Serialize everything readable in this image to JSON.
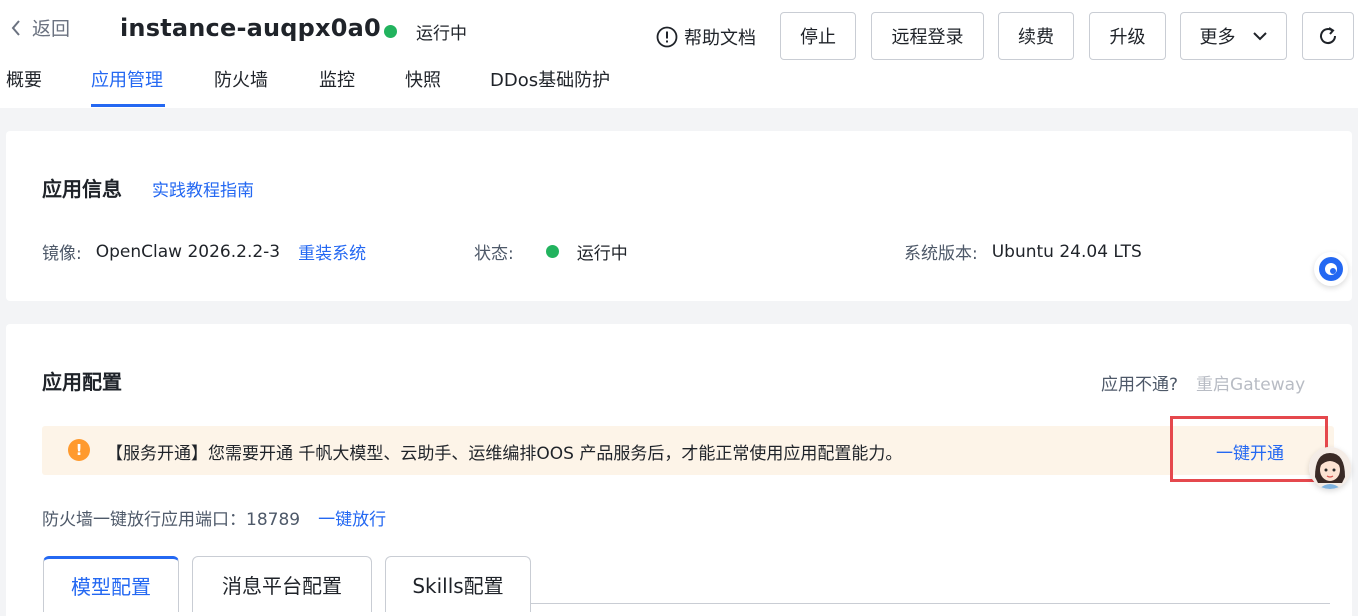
{
  "header": {
    "back_label": "返回",
    "instance_name": "instance-auqpx0a0",
    "status_text": "运行中",
    "status_color": "#22b35e",
    "help_label": "帮助文档",
    "buttons": {
      "stop": "停止",
      "remote_login": "远程登录",
      "renew": "续费",
      "upgrade": "升级",
      "more": "更多"
    }
  },
  "tabs": [
    "概要",
    "应用管理",
    "防火墙",
    "监控",
    "快照",
    "DDos基础防护"
  ],
  "active_tab": "应用管理",
  "app_info": {
    "title": "应用信息",
    "guide_link": "实践教程指南",
    "image_label": "镜像:",
    "image_value": "OpenClaw 2026.2.2-3",
    "reinstall_link": "重装系统",
    "status_label": "状态:",
    "status_value": "运行中",
    "os_label": "系统版本:",
    "os_value": "Ubuntu 24.04 LTS"
  },
  "app_config": {
    "title": "应用配置",
    "unreachable_text": "应用不通?",
    "restart_gateway": "重启Gateway",
    "alert_text": "【服务开通】您需要开通 千帆大模型、云助手、运维编排OOS 产品服务后，才能正常使用应用配置能力。",
    "alert_action": "一键开通",
    "firewall_text": "防火墙一键放行应用端口：18789",
    "firewall_action": "一键放行",
    "config_tabs": [
      "模型配置",
      "消息平台配置",
      "Skills配置"
    ],
    "active_config_tab": "模型配置"
  },
  "colors": {
    "accent": "#2468f2",
    "success": "#22b35e",
    "warning": "#ff9a2e",
    "highlight_box": "#e5484d"
  }
}
